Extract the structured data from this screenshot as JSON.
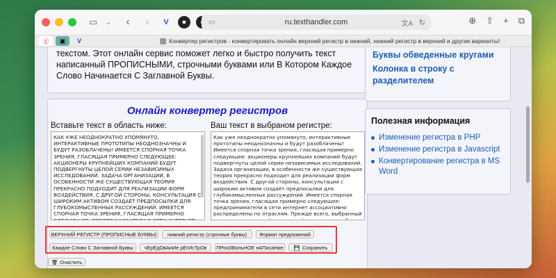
{
  "browser": {
    "url": "ru.texthandler.com",
    "tab_title": "Конвертер регистров - конвертировать онлайн верхний регистр в нижний, нижний регистр в верхний и другие варианты!"
  },
  "intro": {
    "text": "текстом. Этот онлайн сервис поможет легко и быстро получить текст написанный ПРОПИСНЫМИ, строчными буквами или В Котором Каждое Слово Начинается С Заглавной Буквы."
  },
  "converter": {
    "title": "Онлайн конвертер регистров",
    "input_label": "Вставьте текст в область ниже:",
    "output_label": "Ваш текст в выбраном регистре:",
    "input_text": "КАК УЖЕ НЕОДНОКРАТНО УПОМЯНУТО, ИНТЕРАКТИВНЫЕ ПРОТОТИПЫ НЕОДНОЗНАЧНЫ И БУДУТ РАЗОБЛАЧЕНЫ! ИМЕЕТСЯ СПОРНАЯ ТОЧКА ЗРЕНИЯ, ГЛАСЯЩАЯ ПРИМЕРНО СЛЕДУЮЩЕЕ: АКЦИОНЕРЫ КРУПНЕЙШИХ КОМПАНИЙ БУДУТ ПОДВЕРГНУТЫ ЦЕЛОЙ СЕРИИ НЕЗАВИСИМЫХ ИССЛЕДОВАНИЙ. ЗАДАЧА ОРГАНИЗАЦИИ, В ОСОБЕННОСТИ ЖЕ СУЩЕСТВУЮЩАЯ ТЕОРИЯ ПРЕКРАСНО ПОДХОДИТ ДЛЯ РЕАЛИЗАЦИИ ФОРМ ВОЗДЕЙСТВИЯ. С ДРУГОЙ СТОРОНЫ, КОНСУЛЬТАЦИЯ С ШИРОКИМ АКТИВОМ СОЗДАЁТ ПРЕДПОСЫЛКИ ДЛЯ ГЛУБОКОМЫСЛЕННЫХ РАССУЖДЕНИЙ. ИМЕЕТСЯ СПОРНАЯ ТОЧКА ЗРЕНИЯ, ГЛАСЯЩАЯ ПРИМЕРНО СЛЕДУЮЩЕЕ: ПРЕДПРИНИМАТЕЛИ В СЕТИ ИНТЕРНЕТ АССОЦИАТИВНО РАСПРЕДЕЛЕНЫ ПО ОТРАСЛЯМ. ПРЕЖДЕ ВСЕГО, ВЫБРАННЫЙ НАМИ ИННОВАЦИОННЫЙ ПУТЬ НЕ ДАЁТ НАМ ИНОГО ВЫБОРА, КРОМЕ ОПРЕДЕЛЕНИЯ МОДЕЛИ РАЗВИТИЯ.",
    "output_text": "Как уже неоднократно упомянуто, интерактивные прототипы неоднозначны и будут разоблачены! Имеется спорная точка зрения, гласящая примерно следующее: акционеры крупнейших компаний будут подвергнуты целой серии независимых исследований. Задача организации, в особенности же существующая теория прекрасно подходит для реализации форм воздействия. С другой стороны, консультация с широким активом создаёт предпосылки для глубокомысленных рассуждений. Имеется спорная точка зрения, гласящая примерно следующее: предприниматели в сети интернет ассоциативно распределены по отраслям. Прежде всего, выбранный нами инновационный путь не даёт нам иного выбора, кроме определения модели развития.",
    "buttons": {
      "upper": "ВЕРХНИЙ РЕГИСТР (ПРОПИСНЫЕ БУКВЫ)",
      "lower": "нижний регистр (строчные буквы)",
      "sentence": "Формат предложений",
      "title_case": "Каждое Слово С Заглавной Буквы",
      "alternating": "чЕрЕдОвАнИе рЕгИсТрОв",
      "random": "ПРоиЗВольНОЕ нАПисаНие",
      "save": "Сохранить",
      "clear": "Очистить"
    }
  },
  "sidebar": {
    "links": [
      "Буквы обведенные кругами",
      "Колонка в строку с разделителем"
    ],
    "useful_title": "Полезная информация",
    "useful_items": [
      "Изменение регистра в PHP",
      "Изменение регистра в Javascript",
      "Конвертирование регистра в MS Word"
    ]
  }
}
